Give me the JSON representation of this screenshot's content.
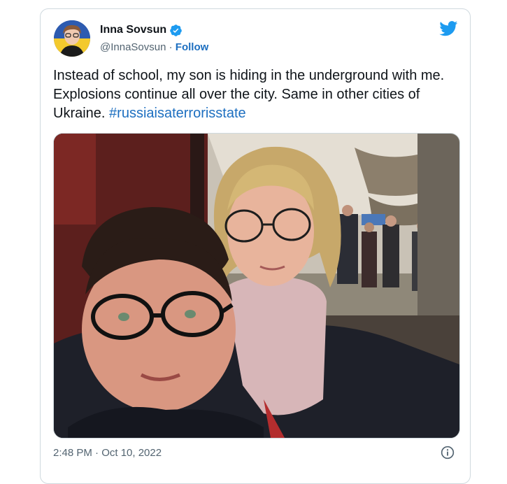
{
  "tweet": {
    "author": {
      "display_name": "Inna Sovsun",
      "handle": "@InnaSovsun",
      "separator": " · ",
      "follow_label": "Follow",
      "verified": true
    },
    "text_main": "Instead of school, my son is hiding in the underground with me. Explosions continue all over the city. Same in other cities of Ukraine. ",
    "hashtag": "#russiaisaterrorisstate",
    "timestamp": "2:48 PM · Oct 10, 2022",
    "icons": {
      "brand": "twitter-bird-icon",
      "verified": "verified-badge-icon",
      "info": "info-icon"
    },
    "colors": {
      "link": "#1d6fc0",
      "twitter_blue": "#1d9bf0",
      "muted": "#536471"
    }
  }
}
